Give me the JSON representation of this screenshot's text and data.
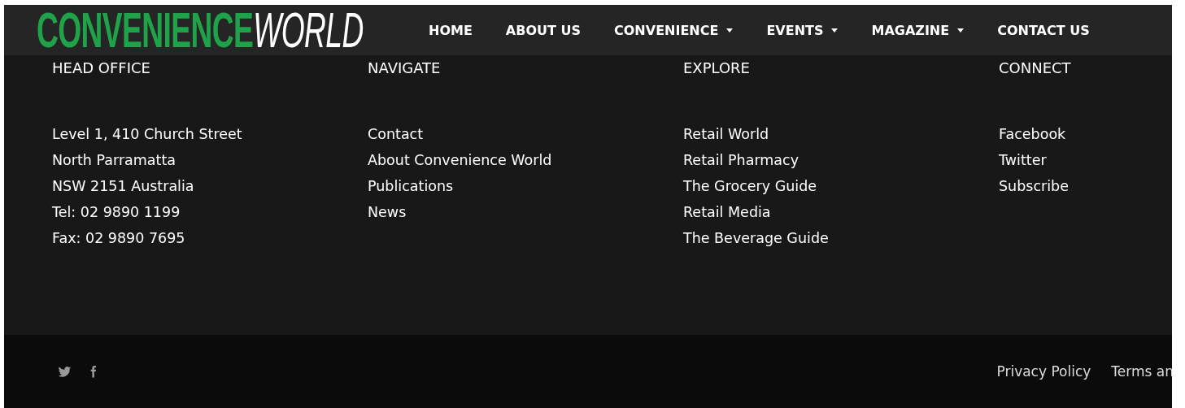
{
  "header": {
    "logo": {
      "part_1": "CONVENIENCE",
      "part_2": "WORLD"
    },
    "nav": [
      {
        "label": "HOME",
        "dropdown": false
      },
      {
        "label": "ABOUT US",
        "dropdown": false
      },
      {
        "label": "CONVENIENCE",
        "dropdown": true
      },
      {
        "label": "EVENTS",
        "dropdown": true
      },
      {
        "label": "MAGAZINE",
        "dropdown": true
      },
      {
        "label": "CONTACT US",
        "dropdown": false
      }
    ]
  },
  "footer": {
    "columns": [
      {
        "heading": "HEAD OFFICE",
        "items": [
          "Level 1, 410 Church Street",
          "North Parramatta",
          "NSW 2151 Australia",
          "Tel: 02 9890 1199",
          "Fax: 02 9890 7695"
        ]
      },
      {
        "heading": "NAVIGATE",
        "items": [
          "Contact",
          "About Convenience World",
          "Publications",
          "News"
        ]
      },
      {
        "heading": "EXPLORE",
        "items": [
          "Retail World",
          "Retail Pharmacy",
          "The Grocery Guide",
          "Retail Media",
          "The Beverage Guide"
        ]
      },
      {
        "heading": "CONNECT",
        "items": [
          "Facebook",
          "Twitter",
          "Subscribe"
        ]
      }
    ]
  },
  "bottom_bar": {
    "social": [
      {
        "kind": "twitter"
      },
      {
        "kind": "facebook"
      }
    ],
    "links": [
      "Privacy Policy",
      "Terms an"
    ]
  }
}
